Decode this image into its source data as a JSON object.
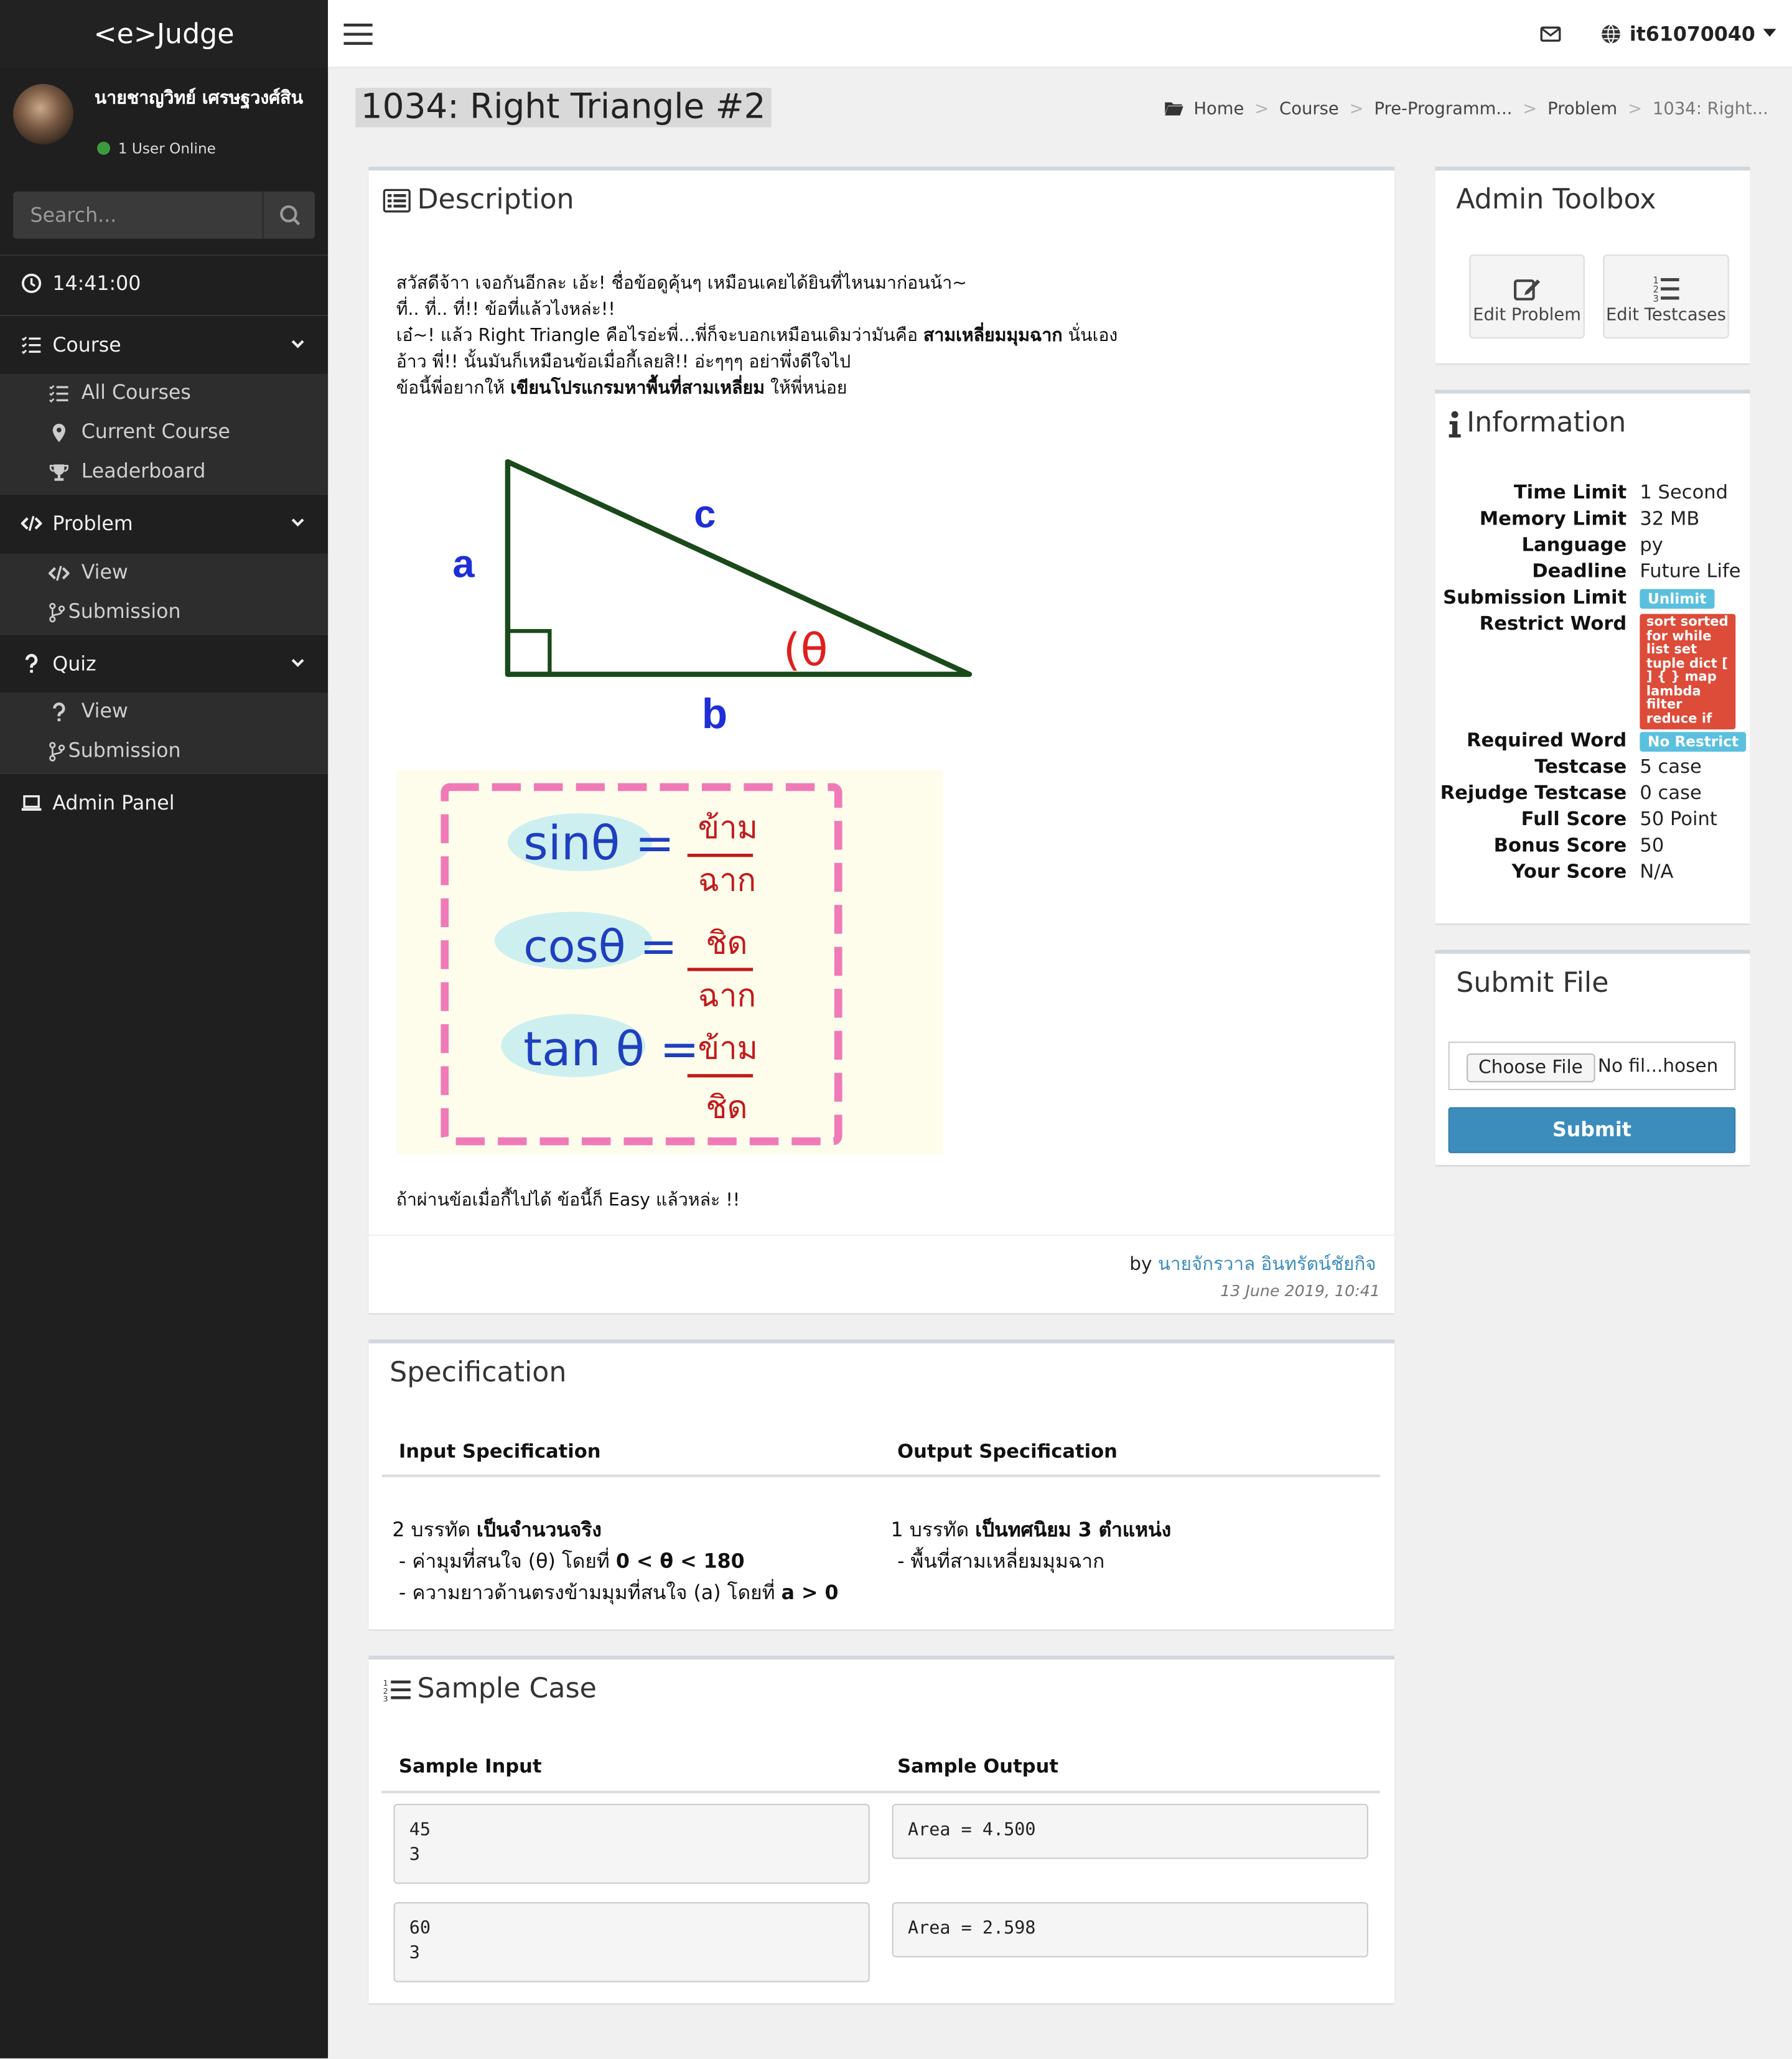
{
  "app": {
    "logo": "<e>Judge"
  },
  "user": {
    "name": "นายชาญวิทย์ เศรษฐวงศ์สิน",
    "status": "1 User Online",
    "username": "it61070040"
  },
  "search": {
    "placeholder": "Search..."
  },
  "clock": "14:41:00",
  "nav": {
    "course": {
      "label": "Course",
      "items": [
        "All Courses",
        "Current Course",
        "Leaderboard"
      ]
    },
    "problem": {
      "label": "Problem",
      "items": [
        "View",
        "Submission"
      ]
    },
    "quiz": {
      "label": "Quiz",
      "items": [
        "View",
        "Submission"
      ]
    },
    "admin": "Admin Panel"
  },
  "page": {
    "title": "1034: Right Triangle #2",
    "breadcrumb": [
      "Home",
      "Course",
      "Pre-Programm...",
      "Problem",
      "1034: Right..."
    ]
  },
  "description": {
    "title": "Description",
    "line1": "สวัสดีจ้าา เจอกันอีกละ เอ้ะ! ชื่อข้อดูคุ้นๆ เหมือนเคยได้ยินที่ไหนมาก่อนน้า~",
    "line2": "ที่.. ที่.. ที่!! ข้อที่แล้วไงหล่ะ!!",
    "line3a": "เอ๋~! แล้ว Right Triangle คือไรอ่ะพี่...พี่ก็จะบอกเหมือนเดิมว่ามันคือ ",
    "line3b": "สามเหลี่ยมมุมฉาก",
    "line3c": " นั่นเอง",
    "line4": "อ้าว พี่!! นั้นมันก็เหมือนข้อเมื่อกี้เลยสิ!! อ่ะๆๆๆ อย่าพึ่งดีใจไป",
    "line5a": "ข้อนี้พี่อยากให้ ",
    "line5b": "เขียนโปรแกรมหาพื้นที่สามเหลี่ยม",
    "line5c": " ให้พี่หน่อย",
    "after": "ถ้าผ่านข้อเมื่อกี้ไปได้ ข้อนี้ก็ Easy แล้วหล่ะ !!",
    "by_prefix": "by ",
    "author": "นายจักรวาล อินทรัตน์ชัยกิจ",
    "date": "13 June 2019, 10:41",
    "figure": {
      "a": "a",
      "b": "b",
      "c": "c",
      "theta": "(θ"
    },
    "notes": {
      "sin": "sinθ =",
      "cos": "cosθ =",
      "tan": "tan θ =",
      "opp": "ข้าม",
      "hyp": "ฉาก",
      "adj": "ชิด"
    }
  },
  "specification": {
    "title": "Specification",
    "input_label": "Input Specification",
    "output_label": "Output Specification",
    "input_l1a": "2 บรรทัด ",
    "input_l1b": "เป็นจำนวนจริง",
    "input_l2a": "- ค่ามุมที่สนใจ (θ) โดยที่ ",
    "input_l2b": "0 < θ < 180",
    "input_l3a": "- ความยาวด้านตรงข้ามมุมที่สนใจ (a) โดยที่ ",
    "input_l3b": "a > 0",
    "output_l1a": "1 บรรทัด ",
    "output_l1b": "เป็นทศนิยม 3 ตำแหน่ง",
    "output_l2": "- พื้นที่สามเหลี่ยมมุมฉาก"
  },
  "sample": {
    "title": "Sample Case",
    "input_label": "Sample Input",
    "output_label": "Sample Output",
    "cases": [
      {
        "in1": "45",
        "in2": "3",
        "out": "Area = 4.500"
      },
      {
        "in1": "60",
        "in2": "3",
        "out": "Area = 2.598"
      }
    ]
  },
  "toolbox": {
    "title": "Admin Toolbox",
    "edit_problem": "Edit Problem",
    "edit_testcases": "Edit Testcases"
  },
  "information": {
    "title": "Information",
    "rows": [
      {
        "k": "Time Limit",
        "v": "1 Second"
      },
      {
        "k": "Memory Limit",
        "v": "32 MB"
      },
      {
        "k": "Language",
        "v": "py"
      },
      {
        "k": "Deadline",
        "v": "Future Life"
      },
      {
        "k": "Submission Limit",
        "badge": "Unlimit"
      },
      {
        "k": "Restrict Word",
        "badge": "sort sorted for while list set tuple dict [ ] { } map lambda filter reduce if"
      },
      {
        "k": "Required Word",
        "badge": "No Restrict"
      },
      {
        "k": "Testcase",
        "v": "5 case"
      },
      {
        "k": "Rejudge Testcase",
        "v": "0 case"
      },
      {
        "k": "Full Score",
        "v": "50 Point"
      },
      {
        "k": "Bonus Score",
        "v": "50"
      },
      {
        "k": "Your Score",
        "v": "N/A"
      }
    ],
    "colors": {
      "info_badge": "#5bc0de",
      "danger_badge": "#dd4b39"
    }
  },
  "submit": {
    "title": "Submit File",
    "choose": "Choose File",
    "filename": "No fil...hosen",
    "button": "Submit"
  }
}
